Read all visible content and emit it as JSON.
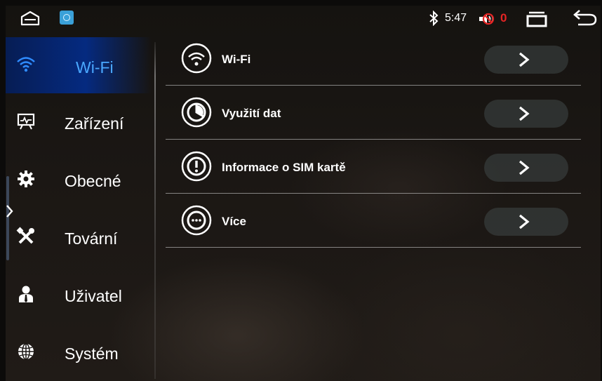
{
  "status_bar": {
    "time": "5:47",
    "volume_level": "0",
    "icons": [
      "home-icon",
      "settings-app-icon",
      "bluetooth-icon",
      "mute-icon",
      "recent-apps-icon",
      "back-icon"
    ],
    "volume_color": "#e52424"
  },
  "sidebar": {
    "items": [
      {
        "label": "Wi-Fi",
        "icon": "wifi-icon",
        "active": true
      },
      {
        "label": "Zařízení",
        "icon": "device-icon",
        "active": false
      },
      {
        "label": "Obecné",
        "icon": "gear-icon",
        "active": false
      },
      {
        "label": "Tovární",
        "icon": "tools-icon",
        "active": false
      },
      {
        "label": "Uživatel",
        "icon": "user-icon",
        "active": false
      },
      {
        "label": "Systém",
        "icon": "globe-icon",
        "active": false
      }
    ],
    "accent_color": "#4aa8ff"
  },
  "main": {
    "rows": [
      {
        "label": "Wi-Fi",
        "icon": "wifi-icon"
      },
      {
        "label": "Využití dat",
        "icon": "data-usage-icon"
      },
      {
        "label": "Informace o SIM kartě",
        "icon": "info-icon"
      },
      {
        "label": "Více",
        "icon": "more-icon"
      }
    ],
    "row_action_icon": "chevron-right-icon"
  }
}
